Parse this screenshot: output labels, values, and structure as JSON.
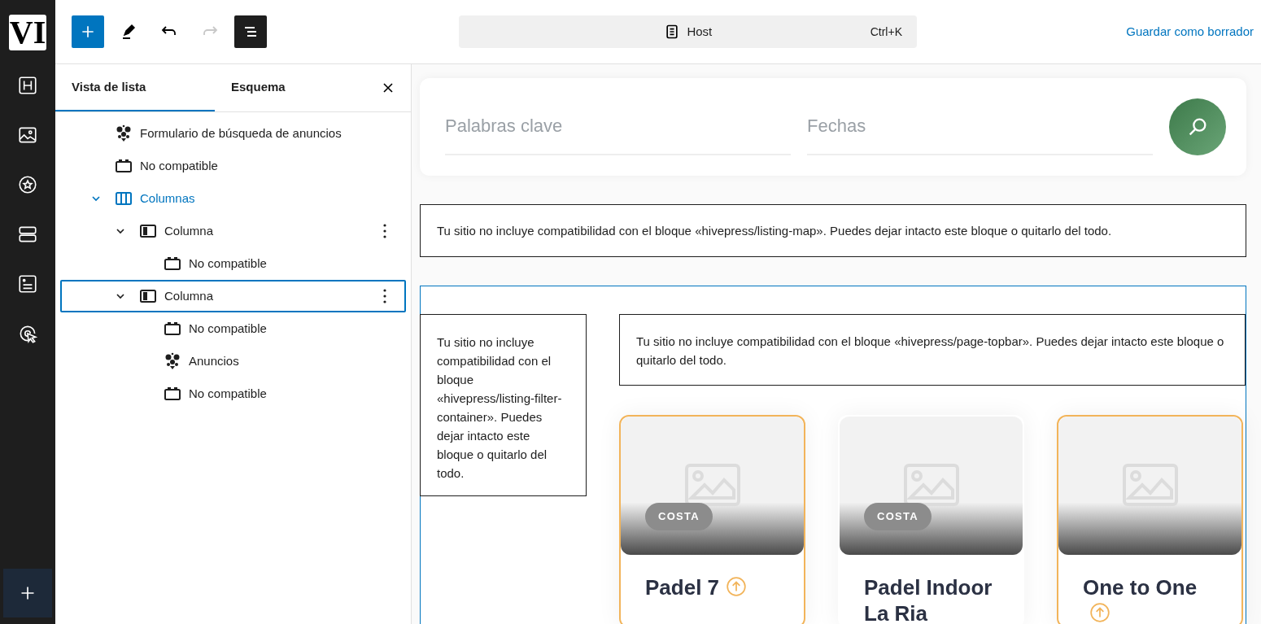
{
  "logo": {
    "text": "VI"
  },
  "toolbar": {
    "document": {
      "title": "Host",
      "shortcut": "Ctrl+K"
    },
    "save_link": "Guardar como borrador",
    "list_view_on": true,
    "redo_disabled": true
  },
  "panel": {
    "tabs": [
      {
        "label": "Vista de lista",
        "selected": true
      },
      {
        "label": "Esquema",
        "selected": false
      }
    ],
    "tree": [
      {
        "kind": "hivepress",
        "label": "Formulario de búsqueda de anuncios",
        "selected": false,
        "highlighted": false
      },
      {
        "kind": "unsupported",
        "label": "No compatible",
        "selected": false,
        "highlighted": false
      },
      {
        "kind": "columns",
        "label": "Columnas",
        "selected": false,
        "highlighted": true,
        "expanded": true,
        "children": [
          {
            "kind": "column",
            "label": "Columna",
            "selected": false,
            "highlighted": false,
            "expanded": true,
            "children": [
              {
                "kind": "unsupported",
                "label": "No compatible",
                "selected": false,
                "highlighted": false
              }
            ]
          },
          {
            "kind": "column",
            "label": "Columna",
            "selected": true,
            "highlighted": false,
            "expanded": true,
            "children": [
              {
                "kind": "unsupported",
                "label": "No compatible",
                "selected": false,
                "highlighted": false
              },
              {
                "kind": "hivepress",
                "label": "Anuncios",
                "selected": false,
                "highlighted": false
              },
              {
                "kind": "unsupported",
                "label": "No compatible",
                "selected": false,
                "highlighted": false
              }
            ]
          }
        ]
      }
    ]
  },
  "canvas": {
    "search_form": {
      "fields": [
        {
          "placeholder": "Palabras clave"
        },
        {
          "placeholder": "Fechas"
        }
      ]
    },
    "map_notice": "Tu sitio no incluye compatibilidad con el bloque «hivepress/listing-map». Puedes dejar intacto este bloque o quitarlo del todo.",
    "filter_notice": "Tu sitio no incluye compatibilidad con el bloque «hivepress/listing-filter-container». Puedes dejar intacto este bloque o quitarlo del todo.",
    "topbar_notice": "Tu sitio no incluye compatibilidad con el bloque «hivepress/page-topbar». Puedes dejar intacto este bloque o quitarlo del todo.",
    "listings": [
      {
        "title": "Padel 7",
        "category": "COSTA",
        "featured": true
      },
      {
        "title": "Padel Indoor La Ria",
        "category": "COSTA",
        "featured": false
      },
      {
        "title": "One to One",
        "featured": true
      }
    ]
  }
}
